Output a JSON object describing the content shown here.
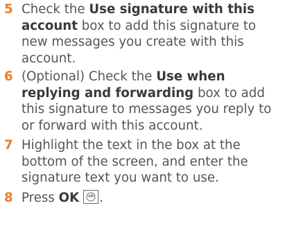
{
  "steps": [
    {
      "number": "5",
      "pre": "Check the ",
      "bold": "Use signature with this account",
      "post": " box to add this signature to new messages you create with this account."
    },
    {
      "number": "6",
      "pre": "(Optional) Check the ",
      "bold": "Use when replying and forwarding",
      "post": " box to add this signature to messages you reply to or forward with this account."
    },
    {
      "number": "7",
      "text": "Highlight the text in the box at the bottom of the screen, and enter the signature text you want to use."
    },
    {
      "number": "8",
      "pre": "Press ",
      "bold": "OK",
      "icon": "ok-key-icon",
      "icon_label": "ok",
      "post": "."
    }
  ],
  "colors": {
    "step_number": "#ef7d23",
    "body_text": "#555555",
    "bold_text": "#3a3a3a"
  }
}
